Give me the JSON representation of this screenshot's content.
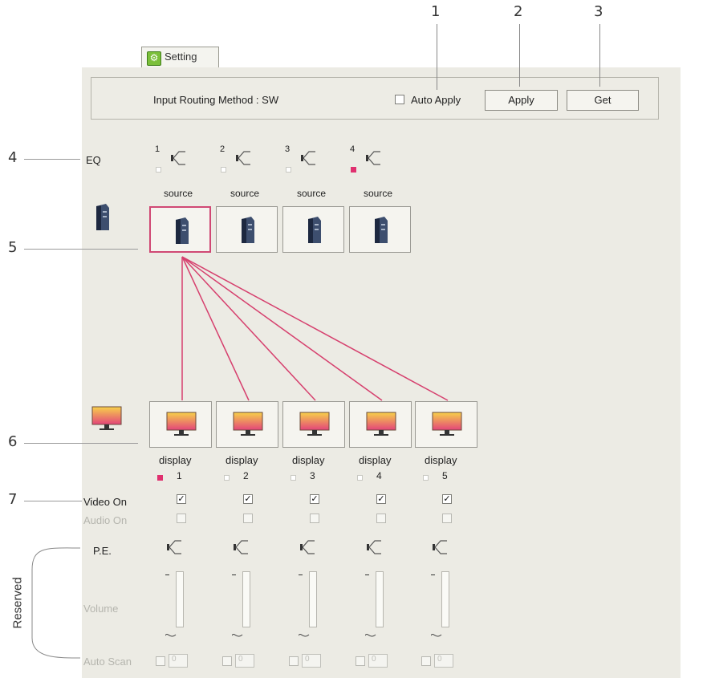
{
  "callouts": [
    "1",
    "2",
    "3",
    "4",
    "5",
    "6",
    "7"
  ],
  "tab": {
    "label": "Setting"
  },
  "header": {
    "routing_label": "Input Routing Method : SW",
    "auto_apply_label": "Auto Apply",
    "apply_label": "Apply",
    "get_label": "Get"
  },
  "eq": {
    "label": "EQ",
    "channels": [
      {
        "num": "1",
        "active": false
      },
      {
        "num": "2",
        "active": false
      },
      {
        "num": "3",
        "active": false
      },
      {
        "num": "4",
        "active": true
      }
    ]
  },
  "sources": [
    {
      "label": "source",
      "selected": true
    },
    {
      "label": "source",
      "selected": false
    },
    {
      "label": "source",
      "selected": false
    },
    {
      "label": "source",
      "selected": false
    }
  ],
  "displays": [
    {
      "label": "display",
      "num": "1",
      "active": true,
      "video_on": true,
      "audio_on": false,
      "auto_scan": "0"
    },
    {
      "label": "display",
      "num": "2",
      "active": false,
      "video_on": true,
      "audio_on": false,
      "auto_scan": "0"
    },
    {
      "label": "display",
      "num": "3",
      "active": false,
      "video_on": true,
      "audio_on": false,
      "auto_scan": "0"
    },
    {
      "label": "display",
      "num": "4",
      "active": false,
      "video_on": true,
      "audio_on": false,
      "auto_scan": "0"
    },
    {
      "label": "display",
      "num": "5",
      "active": false,
      "video_on": true,
      "audio_on": false,
      "auto_scan": "0"
    }
  ],
  "routing": {
    "from_source": 1,
    "to_displays": [
      1,
      2,
      3,
      4,
      5
    ]
  },
  "rows": {
    "video_on": "Video On",
    "audio_on": "Audio On",
    "pe": "P.E.",
    "volume": "Volume",
    "auto_scan": "Auto Scan",
    "reserved": "Reserved"
  },
  "colors": {
    "accent": "#d6406e",
    "panel": "#ecebe4"
  }
}
